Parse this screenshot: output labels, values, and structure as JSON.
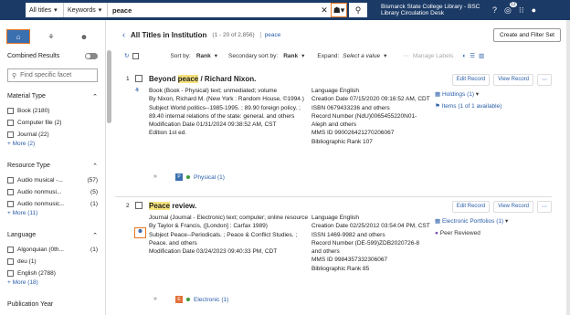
{
  "topbar": {
    "scope": "All titles",
    "field": "Keywords",
    "query": "peace",
    "location": "Bismarck State College Library - BSC Library Circulation Desk",
    "notif_count": "13"
  },
  "sidebar": {
    "combined_label": "Combined Results",
    "facet_search_placeholder": "Find specific facet",
    "groups": [
      {
        "title": "Material Type",
        "items": [
          {
            "label": "Book (2180)",
            "count": ""
          },
          {
            "label": "Computer file (2)",
            "count": ""
          },
          {
            "label": "Journal (22)",
            "count": ""
          }
        ],
        "more": "More (2)"
      },
      {
        "title": "Resource Type",
        "items": [
          {
            "label": "Audio musical -...",
            "count": "(57)"
          },
          {
            "label": "Audio nonmusi...",
            "count": "(5)"
          },
          {
            "label": "Audio nonmusic...",
            "count": "(1)"
          }
        ],
        "more": "More (11)"
      },
      {
        "title": "Language",
        "items": [
          {
            "label": "Algonquian (0th...",
            "count": "(1)"
          },
          {
            "label": "deu (1)",
            "count": ""
          },
          {
            "label": "English (2788)",
            "count": ""
          }
        ],
        "more": "More (18)"
      },
      {
        "title": "Publication Year",
        "items": [],
        "more": ""
      }
    ]
  },
  "main": {
    "title": "All Titles in Institution",
    "count": "(1 - 20 of 2,856)",
    "keyword": "peace",
    "create_btn": "Create and Filter Set",
    "sort_by_label": "Sort by:",
    "sort_by_value": "Rank",
    "secondary_label": "Secondary sort by:",
    "secondary_value": "Rank",
    "expand_label": "Expand:",
    "expand_value": "Select a value",
    "manage_labels": "Manage Labels"
  },
  "records": [
    {
      "num": "1",
      "title_pre": "Beyond ",
      "title_mark": "peace",
      "title_post": " / Richard Nixon.",
      "btn_edit": "Edit Record",
      "btn_view": "View Record",
      "col1": [
        "Book (Book - Physical) text; unmediated; volume",
        "By Nixon, Richard M. (New York : Random House, ©1994.)",
        "Subject World politics--1985-1995. ; 89.90 foreign policy. ; 89.40 internal relations of the state: general. and others",
        "Modification Date 01/31/2024 09:38:52 AM, CST",
        "Edition 1st ed."
      ],
      "col2": [
        "Language English",
        "Creation Date 07/15/2020 09:16:52 AM, CDT",
        "ISBN 0679433236 and others",
        "Record Number (NdU)0065455220N01-Aleph and others",
        "MMS ID 990026421270206067",
        "Bibliographic Rank 107"
      ],
      "col3": [
        "Holdings (1)",
        "Items (1 of 1 available)"
      ],
      "tag": "P",
      "tag_color": "#3a6fb0",
      "access": "Physical (1)"
    },
    {
      "num": "2",
      "title_pre": "",
      "title_mark": "Peace",
      "title_post": " review.",
      "btn_edit": "Edit Record",
      "btn_view": "View Record",
      "col1": [
        "Journal (Journal - Electronic) text; computer; online resource",
        "By Taylor & Francis, ([London] : Carfax 1989)",
        "Subject Peace--Periodicals. ; Peace & Conflict Studies. ; Peace. and others",
        "Modification Date 03/24/2023 09:40:33 PM, CDT"
      ],
      "col2": [
        "Language English",
        "Creation Date 02/25/2012 03:54:04 PM, CST",
        "ISSN 1469-9982 and others",
        "Record Number (DE-599)ZDB2020726-8 and others",
        "MMS ID 9984357332306067",
        "Bibliographic Rank 85"
      ],
      "col3": [
        "Electronic Portfolios (1)",
        "Peer Reviewed"
      ],
      "tag": "E",
      "tag_color": "#e0703a",
      "access": "Electronic (1)"
    }
  ]
}
